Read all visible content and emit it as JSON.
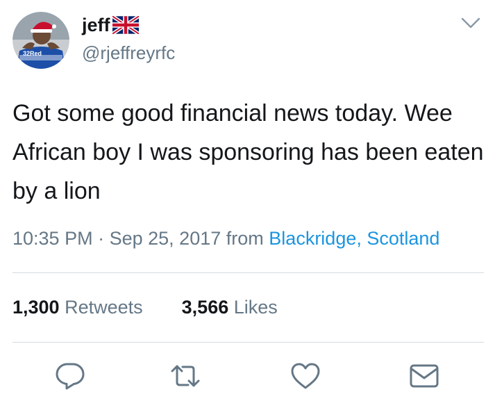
{
  "user": {
    "display_name": "jeff",
    "flag_icon": "uk-flag-icon",
    "handle": "@rjeffreyrfc",
    "avatar_badge_text": "32Red"
  },
  "tweet": {
    "text": "Got some good financial news today. Wee African boy I was sponsoring has been eaten by a lion",
    "time": "10:35 PM",
    "separator": "·",
    "date": "Sep 25, 2017",
    "from_label": "from",
    "location": "Blackridge, Scotland"
  },
  "stats": {
    "retweets_count": "1,300",
    "retweets_label": "Retweets",
    "likes_count": "3,566",
    "likes_label": "Likes"
  },
  "actions": [
    "reply-icon",
    "retweet-icon",
    "like-icon",
    "direct-message-icon"
  ],
  "colors": {
    "text": "#14171a",
    "secondary": "#657786",
    "link": "#1b95e0",
    "divider": "#d5dbe0"
  }
}
